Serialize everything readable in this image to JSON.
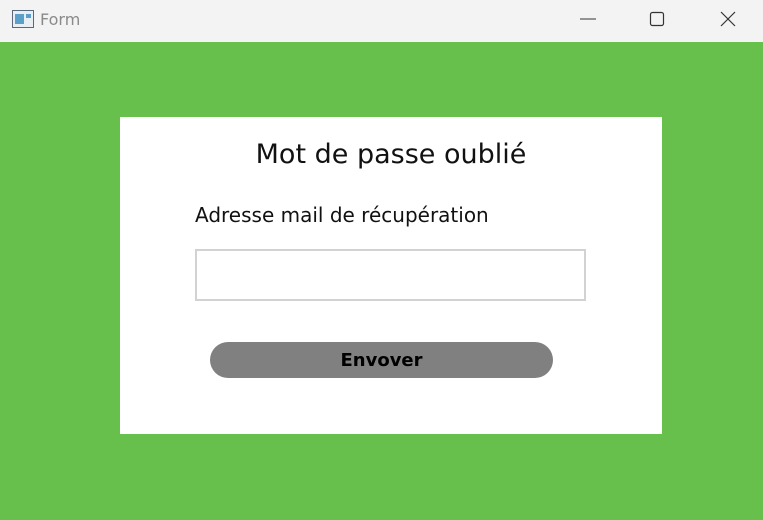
{
  "window": {
    "title": "Form",
    "icon": "app-window-icon",
    "controls": [
      "minimize-icon",
      "maximize-icon",
      "close-icon"
    ]
  },
  "form": {
    "title": "Mot de passe oublié",
    "email_label": "Adresse mail de récupération",
    "email_value": "",
    "email_placeholder": "",
    "submit_label": "Envover"
  },
  "colors": {
    "background": "#67bf4c",
    "card": "#ffffff",
    "button": "#808080",
    "titlebar": "#f3f3f3"
  }
}
